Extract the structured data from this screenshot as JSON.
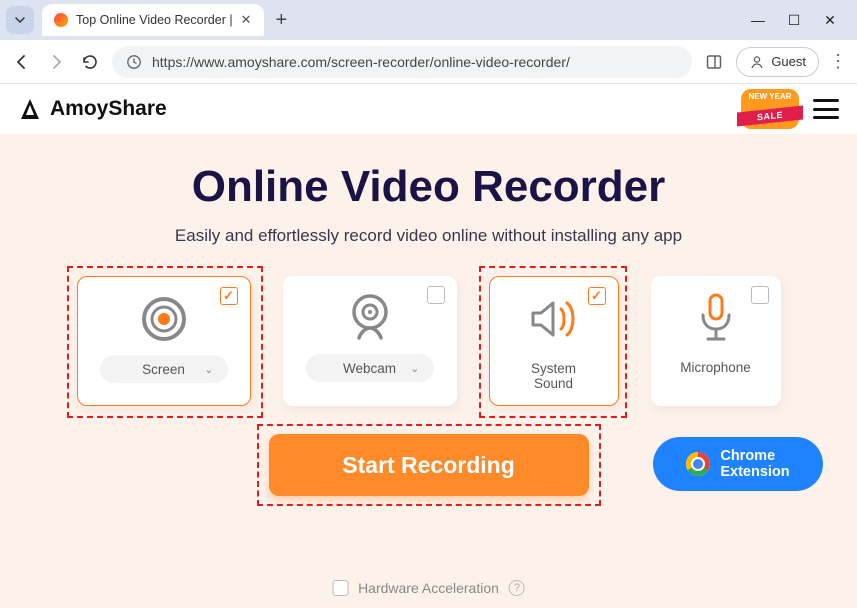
{
  "browser": {
    "tab_title": "Top Online Video Recorder |",
    "url": "https://www.amoyshare.com/screen-recorder/online-video-recorder/",
    "guest_label": "Guest"
  },
  "header": {
    "brand": "AmoyShare",
    "sale_top": "NEW YEAR",
    "sale_ribbon": "SALE"
  },
  "hero": {
    "title": "Online Video Recorder",
    "subtitle": "Easily and effortlessly record video online without installing any app"
  },
  "options": {
    "screen": {
      "label": "Screen",
      "checked": true,
      "highlighted": true,
      "hasDropdown": true
    },
    "webcam": {
      "label": "Webcam",
      "checked": false,
      "highlighted": false,
      "hasDropdown": true
    },
    "system_sound": {
      "label": "System\nSound",
      "checked": true,
      "highlighted": true,
      "hasDropdown": false
    },
    "microphone": {
      "label": "Microphone",
      "checked": false,
      "highlighted": false,
      "hasDropdown": false
    }
  },
  "cta": {
    "start": "Start Recording",
    "extension": "Chrome\nExtension"
  },
  "footer": {
    "hw_accel": "Hardware Acceleration"
  }
}
